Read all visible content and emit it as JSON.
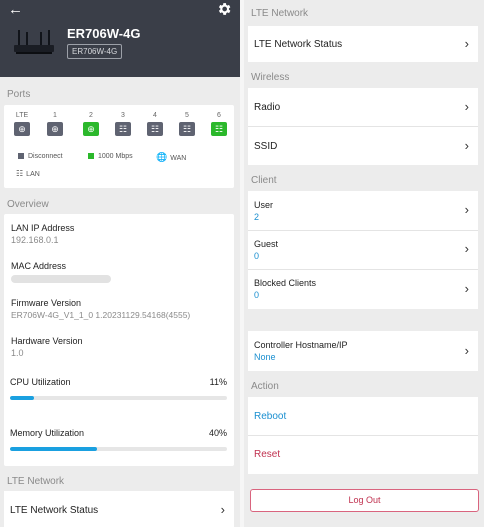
{
  "header": {
    "model": "ER706W-4G",
    "badge": "ER706W-4G"
  },
  "ports": {
    "section_title": "Ports",
    "items": [
      {
        "label": "LTE",
        "icon": "globe-icon",
        "status": "disconnect"
      },
      {
        "label": "1",
        "icon": "globe-icon",
        "status": "disconnect"
      },
      {
        "label": "2",
        "icon": "globe-icon",
        "status": "connected"
      },
      {
        "label": "3",
        "icon": "lan-icon",
        "status": "disconnect"
      },
      {
        "label": "4",
        "icon": "lan-icon",
        "status": "disconnect"
      },
      {
        "label": "5",
        "icon": "lan-icon",
        "status": "disconnect"
      },
      {
        "label": "6",
        "icon": "lan-icon",
        "status": "connected"
      }
    ],
    "legend": {
      "disconnect": "Disconnect",
      "speed": "1000 Mbps",
      "wan": "WAN",
      "lan": "LAN"
    }
  },
  "overview": {
    "section_title": "Overview",
    "lan_ip_label": "LAN IP Address",
    "lan_ip_value": "192.168.0.1",
    "mac_label": "MAC Address",
    "firmware_label": "Firmware Version",
    "firmware_value": "ER706W-4G_V1_1_0 1.20231129.54168(4555)",
    "hardware_label": "Hardware Version",
    "hardware_value": "1.0",
    "cpu_label": "CPU Utilization",
    "cpu_pct_text": "11%",
    "cpu_pct": 11,
    "mem_label": "Memory Utilization",
    "mem_pct_text": "40%",
    "mem_pct": 40
  },
  "lte": {
    "section_title": "LTE Network",
    "status_label": "LTE Network Status"
  },
  "wireless": {
    "section_title": "Wireless",
    "radio_label": "Radio",
    "ssid_label": "SSID"
  },
  "client": {
    "section_title": "Client",
    "user_label": "User",
    "user_value": "2",
    "guest_label": "Guest",
    "guest_value": "0",
    "blocked_label": "Blocked Clients",
    "blocked_value": "0"
  },
  "controller": {
    "label": "Controller Hostname/IP",
    "value": "None"
  },
  "action": {
    "section_title": "Action",
    "reboot": "Reboot",
    "reset": "Reset",
    "logout": "Log Out"
  },
  "colors": {
    "header_bg": "#3a3e48",
    "port_on": "#2bb82b",
    "port_off": "#5f6371",
    "accent": "#1a8fd0",
    "danger": "#c0314f"
  }
}
